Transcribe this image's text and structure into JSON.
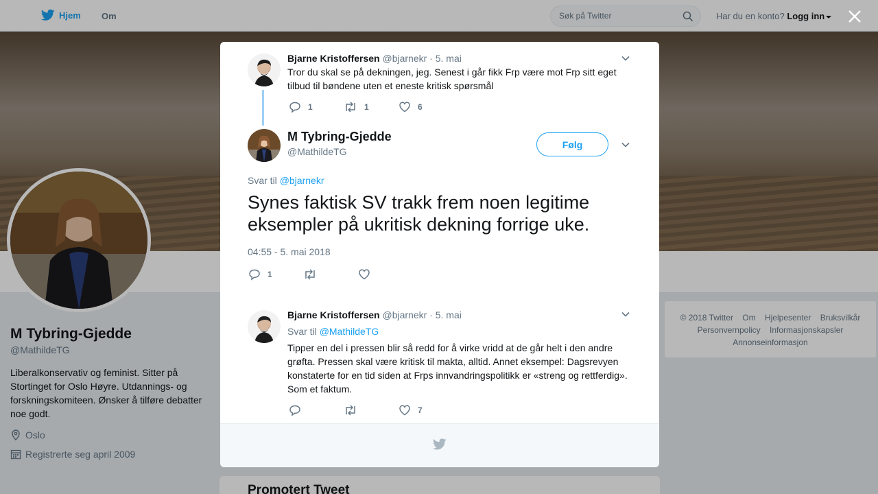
{
  "topbar": {
    "home_label": "Hjem",
    "about_label": "Om",
    "search_placeholder": "Søk på Twitter",
    "login_prompt": "Har du en konto?",
    "login_label": "Logg inn"
  },
  "profile": {
    "name": "M Tybring-Gjedde",
    "handle": "@MathildeTG",
    "bio": "Liberalkonservativ og feminist. Sitter på Stortinget for Oslo Høyre. Utdannings- og forskningskomiteen. Ønsker å tilføre debatter noe godt.",
    "location": "Oslo",
    "joined": "Registrerte seg april 2009"
  },
  "footer": {
    "links": [
      "© 2018 Twitter",
      "Om",
      "Hjelpesenter",
      "Bruksvilkår",
      "Personvernpolicy",
      "Informasjonskapsler",
      "Annonseinformasjon"
    ]
  },
  "promoted": {
    "title": "Promotert Tweet"
  },
  "modal": {
    "parent_tweet": {
      "name": "Bjarne Kristoffersen",
      "handle": "@bjarnekr",
      "date": "· 5. mai",
      "text": "Tror du skal se på dekningen, jeg. Senest i går fikk Frp være mot Frp sitt eget tilbud til bøndene uten et eneste kritisk spørsmål",
      "replies": "1",
      "retweets": "1",
      "likes": "6"
    },
    "main_tweet": {
      "name": "M Tybring-Gjedde",
      "handle": "@MathildeTG",
      "follow_label": "Følg",
      "reply_prefix": "Svar til",
      "reply_handle": "@bjarnekr",
      "text": "Synes faktisk SV trakk frem noen legitime eksempler på ukritisk dekning forrige uke.",
      "timestamp": "04:55 - 5. mai 2018",
      "replies": "1"
    },
    "reply_tweet": {
      "name": "Bjarne Kristoffersen",
      "handle": "@bjarnekr",
      "date": "· 5. mai",
      "reply_prefix": "Svar til",
      "reply_handle": "@MathildeTG",
      "text": "Tipper en del i pressen blir så redd for å virke vridd at de går helt i den andre grøfta. Pressen skal være kritisk til makta, alltid. Annet eksempel: Dagsrevyen konstaterte for en tid siden at Frps innvandringspolitikk er «streng og rettferdig». Som et faktum.",
      "likes": "7"
    }
  },
  "colors": {
    "accent": "#1da1f2",
    "muted": "#657786",
    "text": "#14171a"
  }
}
